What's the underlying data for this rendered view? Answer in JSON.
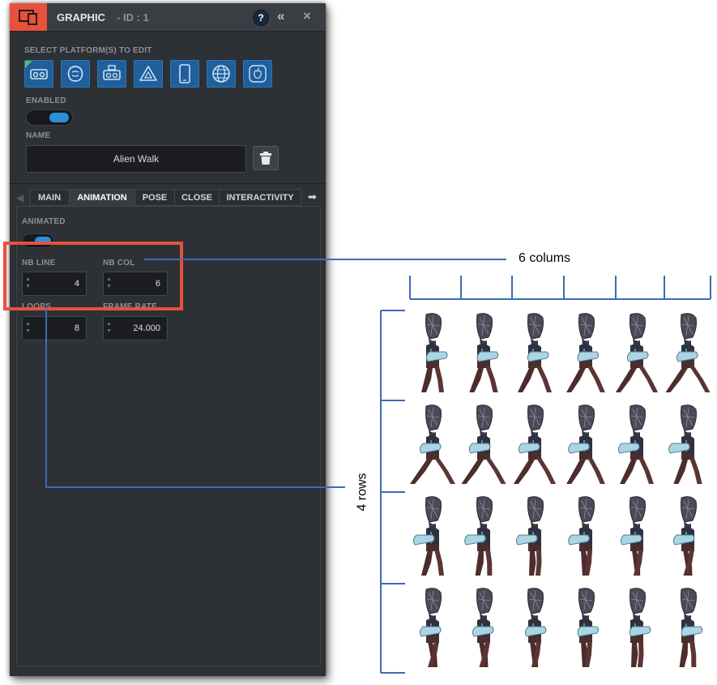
{
  "window": {
    "title": "GRAPHIC",
    "id_label": "- ID : 1",
    "help_label": "?",
    "collapse_label": "«",
    "close_label": "×"
  },
  "platforms": {
    "label": "SELECT PLATFORM(S) TO EDIT",
    "items": [
      {
        "icon": "vr-cardboard-icon",
        "selected": true
      },
      {
        "icon": "vr-headset-round-icon"
      },
      {
        "icon": "vr-headset-icon"
      },
      {
        "icon": "oculus-go-icon"
      },
      {
        "icon": "phone-icon"
      },
      {
        "icon": "globe-icon"
      },
      {
        "icon": "apple-icon"
      }
    ]
  },
  "enabled": {
    "label": "ENABLED",
    "on": true
  },
  "name": {
    "label": "NAME",
    "value": "Alien Walk"
  },
  "tabs": [
    "MAIN",
    "ANIMATION",
    "POSE",
    "CLOSE",
    "INTERACTIVITY"
  ],
  "active_tab": "ANIMATION",
  "animation": {
    "animated_label": "ANIMATED",
    "animated_on": true,
    "nb_line_label": "NB LINE",
    "nb_line_value": "4",
    "nb_col_label": "NB COL",
    "nb_col_value": "6",
    "loops_label": "LOOPS",
    "loops_value": "8",
    "frame_rate_label": "FRAME RATE",
    "frame_rate_value": "24.000"
  },
  "annotations": {
    "columns_label": "6 colums",
    "rows_label": "4 rows"
  },
  "sprite_sheet": {
    "rows": 4,
    "cols": 6
  },
  "colors": {
    "accent_red": "#e8503b",
    "platform_blue": "#1f5f9c",
    "toggle_blue": "#2b8fd8",
    "annotation_blue": "#3c6cb4",
    "panel_bg": "#2d3035"
  }
}
